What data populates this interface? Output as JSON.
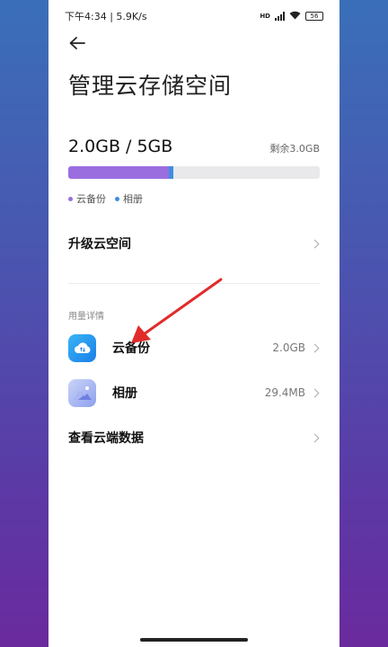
{
  "status": {
    "time_speed": "下午4:34 | 5.9K/s",
    "network": "HD",
    "battery": "56"
  },
  "page": {
    "title": "管理云存储空间"
  },
  "storage": {
    "usage": "2.0GB / 5GB",
    "remaining": "剩余3.0GB",
    "backup_fraction": 0.4,
    "album_fraction": 0.0057,
    "legend": [
      {
        "label": "云备份",
        "color": "#9b6ee0"
      },
      {
        "label": "相册",
        "color": "#3d8fe0"
      }
    ]
  },
  "upgrade": {
    "label": "升级云空间"
  },
  "details": {
    "section_title": "用量详情",
    "items": [
      {
        "label": "云备份",
        "value": "2.0GB",
        "icon": "cloud-backup-icon"
      },
      {
        "label": "相册",
        "value": "29.4MB",
        "icon": "gallery-icon"
      }
    ]
  },
  "view_cloud": {
    "label": "查看云端数据"
  },
  "colors": {
    "backup": "#9b6ee0",
    "album": "#3d8fe0",
    "arrow": "#e02b2b"
  }
}
